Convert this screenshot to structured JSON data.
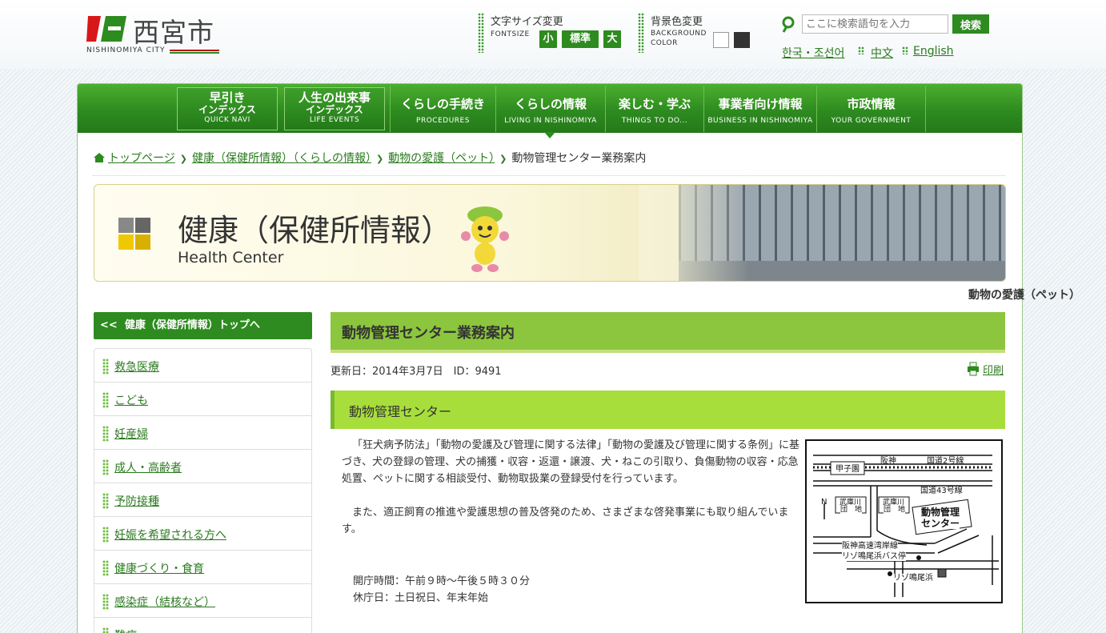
{
  "header": {
    "logo_text": "西宮市",
    "logo_sub": "NISHINOMIYA CITY",
    "fontsize": {
      "label": "文字サイズ変更",
      "sub": "FONTSIZE",
      "small": "小",
      "standard": "標準",
      "large": "大"
    },
    "bgcolor": {
      "label": "背景色変更",
      "sub1": "BACKGROUND",
      "sub2": "COLOR",
      "white": "#ffffff",
      "black": "#333333"
    },
    "search": {
      "placeholder": "ここに検索語句を入力",
      "button": "検索"
    },
    "languages": [
      "한국・조선어",
      "中文",
      "English"
    ]
  },
  "nav": {
    "quick1": {
      "main": "早引き",
      "mid": "インデックス",
      "sub": "QUICK NAVI"
    },
    "quick2": {
      "main": "人生の出来事",
      "mid": "インデックス",
      "sub": "LIFE EVENTS"
    },
    "items": [
      {
        "label": "くらしの手続き",
        "sub": "PROCEDURES"
      },
      {
        "label": "くらしの情報",
        "sub": "LIVING IN NISHINOMIYA"
      },
      {
        "label": "楽しむ・学ぶ",
        "sub": "THINGS TO DO..."
      },
      {
        "label": "事業者向け情報",
        "sub": "BUSINESS IN NISHINOMIYA"
      },
      {
        "label": "市政情報",
        "sub": "YOUR GOVERNMENT"
      }
    ]
  },
  "breadcrumb": {
    "items": [
      "トップページ",
      "健康（保健所情報）（くらしの情報）",
      "動物の愛護（ペット）"
    ],
    "current": "動物管理センター業務案内"
  },
  "banner": {
    "title": "健康（保健所情報）",
    "subtitle": "Health Center",
    "category": "動物の愛護（ペット）"
  },
  "sidebar": {
    "top": "健康（保健所情報）トップへ",
    "items": [
      "救急医療",
      "こども",
      "妊産婦",
      "成人・高齢者",
      "予防接種",
      "妊娠を希望される方へ",
      "健康づくり・食育",
      "感染症（結核など）",
      "難病"
    ]
  },
  "main": {
    "title": "動物管理センター業務案内",
    "updated": "更新日：2014年3月7日　ID：9491",
    "print": "印刷",
    "section": "動物管理センター",
    "para1": "「狂犬病予防法」「動物の愛護及び管理に関する法律」「動物の愛護及び管理に関する条例」に基づき、犬の登録の管理、犬の捕獲・収容・返還・譲渡、犬・ねこの引取り、負傷動物の収容・応急処置、ペットに関する相談受付、動物取扱業の登録受付を行っています。",
    "para2": "また、適正飼育の推進や愛護思想の普及啓発のため、さまざまな啓発事業にも取り組んでいます。",
    "hours": "開庁時間：午前９時～午後５時３０分",
    "closed": "休庁日：土日祝日、年末年始"
  },
  "map": {
    "koshien": "甲子園",
    "hanshin": "阪神",
    "route2": "国道2号線",
    "route43": "国道43号線",
    "n": "N",
    "danchi1a": "武庫川",
    "danchi1b": "団　地",
    "danchi2a": "武庫川",
    "danchi2b": "団　地",
    "center1": "動物管理",
    "center2": "センター",
    "wangan": "阪神高速湾岸線",
    "busstop": "リゾ鳴尾浜バス停",
    "rizo": "リゾ鳴尾浜"
  }
}
